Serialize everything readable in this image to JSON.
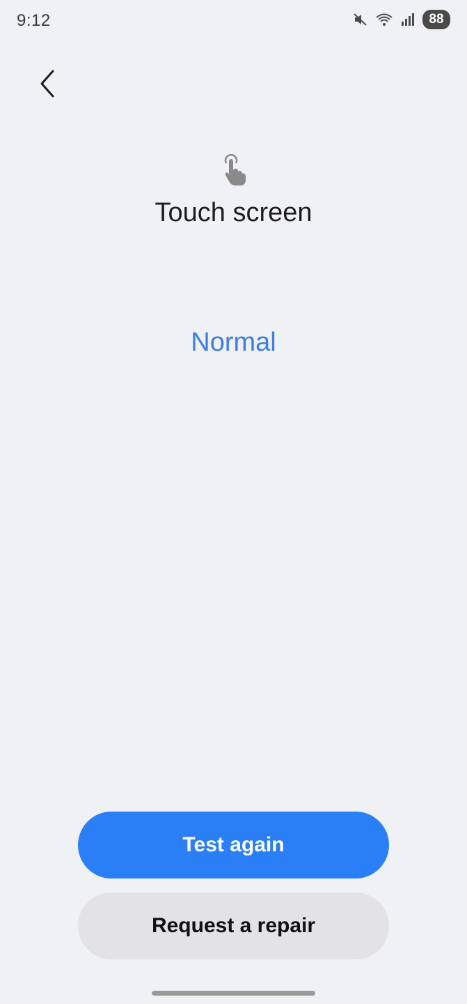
{
  "status_bar": {
    "time": "9:12",
    "battery": "88",
    "icons": [
      "mute-icon",
      "wifi-icon",
      "signal-icon"
    ]
  },
  "header": {
    "back_icon": "chevron-left-icon"
  },
  "main": {
    "icon": "touch-hand-icon",
    "title": "Touch screen",
    "result": "Normal"
  },
  "actions": {
    "test_again_label": "Test again",
    "request_repair_label": "Request a repair"
  },
  "colors": {
    "background": "#f0f1f5",
    "accent": "#2a7ff6",
    "result_text": "#3d7fe0",
    "secondary_button": "#e3e3e6"
  }
}
